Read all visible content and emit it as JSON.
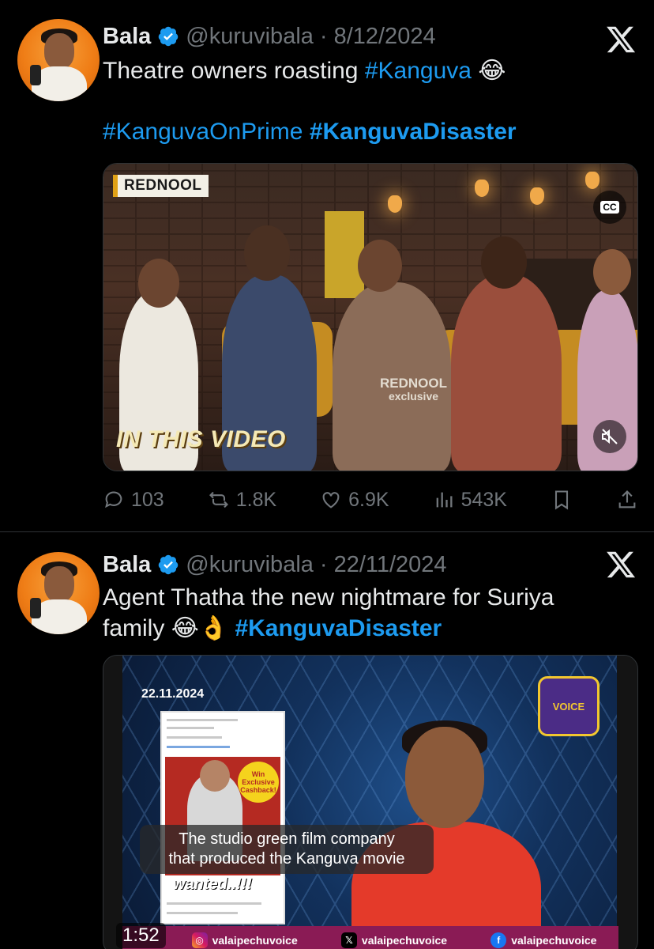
{
  "tweets": [
    {
      "author": {
        "name": "Bala",
        "handle": "@kuruvibala",
        "verified": true
      },
      "separator": "·",
      "date": "8/12/2024",
      "text_line1": "Theatre owners roasting",
      "text_line1_tag": "#Kanguva",
      "text_line1_emoji": "😂",
      "tags_line": [
        "#KanguvaOnPrime",
        "#KanguvaDisaster"
      ],
      "video": {
        "badge": "REDNOOL",
        "watermark_line1": "REDNOOL",
        "watermark_line2": "exclusive",
        "caption": "IN THIS VIDEO",
        "cc_label": "CC"
      },
      "stats": {
        "replies": "103",
        "retweets": "1.8K",
        "likes": "6.9K",
        "views": "543K"
      }
    },
    {
      "author": {
        "name": "Bala",
        "handle": "@kuruvibala",
        "verified": true
      },
      "separator": "·",
      "date": "22/11/2024",
      "text_line1": "Agent Thatha the new nightmare for Suriya",
      "text_line2": "family",
      "text_line2_emoji": "😂👌",
      "text_line2_tag": "#KanguvaDisaster",
      "video": {
        "date": "22.11.2024",
        "subtitle_line1": "The studio green film company",
        "subtitle_line2": "that produced the Kanguva movie",
        "duration": "1:52",
        "inset_wanted": "wanted..!!!",
        "inset_burst": "Win Exclusive Cashback!",
        "socials": [
          "valaipechuvoice",
          "valaipechuvoice",
          "valaipechuvoice"
        ]
      }
    }
  ],
  "colors": {
    "accent": "#1d9bf0",
    "muted": "#71767b",
    "background": "#000000"
  },
  "icons": [
    "verified-badge-icon",
    "x-logo-icon",
    "reply-icon",
    "retweet-icon",
    "like-icon",
    "views-icon",
    "bookmark-icon",
    "share-icon",
    "cc-icon",
    "mute-icon"
  ]
}
